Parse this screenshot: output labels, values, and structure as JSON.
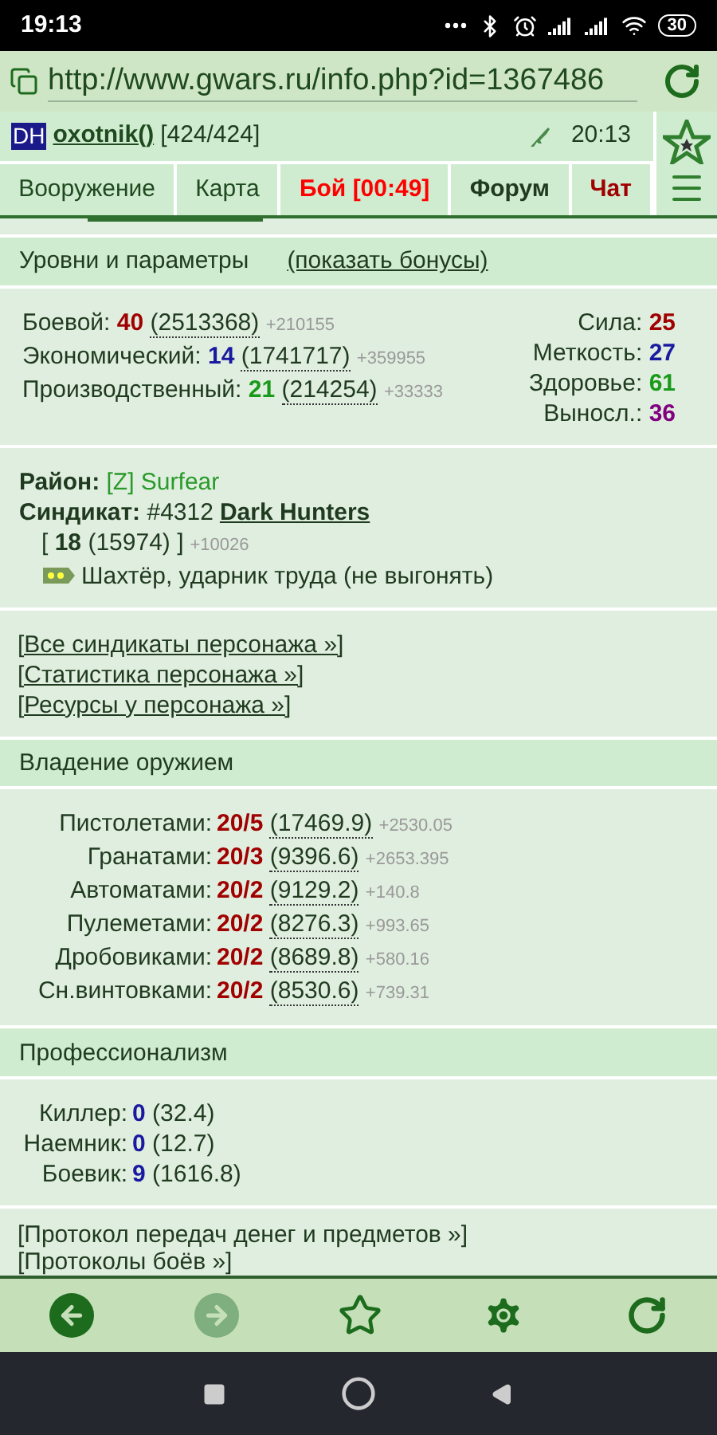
{
  "status_bar": {
    "time": "19:13",
    "battery": "30"
  },
  "browser": {
    "url": "http://www.gwars.ru/info.php?id=1367486"
  },
  "header": {
    "clan_tag": "DH",
    "player": "oxotnik()",
    "hp": "[424/424]",
    "server_time": "20:13"
  },
  "tabs": [
    {
      "label": "Вооружение",
      "kind": "normal"
    },
    {
      "label": "Карта",
      "kind": "normal"
    },
    {
      "label": "Бой [00:49]",
      "kind": "alert"
    },
    {
      "label": "Форум",
      "kind": "bold"
    },
    {
      "label": "Чат",
      "kind": "warn"
    }
  ],
  "levels": {
    "title": "Уровни и параметры",
    "bonus_link": "(показать бонусы)",
    "rows": [
      {
        "label": "Боевой:",
        "value": "40",
        "exp": "(2513368)",
        "gain": "+210155",
        "color": "#a00000"
      },
      {
        "label": "Экономический:",
        "value": "14",
        "exp": "(1741717)",
        "gain": "+359955",
        "color": "#1a1aa0"
      },
      {
        "label": "Производственный:",
        "value": "21",
        "exp": "(214254)",
        "gain": "+33333",
        "color": "#1a9a1a"
      }
    ],
    "stats": [
      {
        "label": "Сила:",
        "value": "25",
        "color": "#a00000"
      },
      {
        "label": "Меткость:",
        "value": "27",
        "color": "#1a1aa0"
      },
      {
        "label": "Здоровье:",
        "value": "61",
        "color": "#1a9a1a"
      },
      {
        "label": "Выносл.:",
        "value": "36",
        "color": "#800080"
      }
    ]
  },
  "district": {
    "label": "Район:",
    "value": "[Z] Surfear"
  },
  "syndicate": {
    "label": "Синдикат:",
    "number": "#4312",
    "name": "Dark Hunters",
    "level": "[ **18** (15974) ]",
    "gain": "+10026",
    "rank": "Шахтёр, ударник труда (не выгонять)"
  },
  "links": [
    "[Все синдикаты персонажа »]",
    "[Статистика персонажа »]",
    "[Ресурсы у персонажа »]"
  ],
  "weapons": {
    "title": "Владение оружием",
    "rows": [
      {
        "label": "Пистолетами:",
        "value": "20/5",
        "exp": "(17469.9)",
        "gain": "+2530.05"
      },
      {
        "label": "Гранатами:",
        "value": "20/3",
        "exp": "(9396.6)",
        "gain": "+2653.395"
      },
      {
        "label": "Автоматами:",
        "value": "20/2",
        "exp": "(9129.2)",
        "gain": "+140.8"
      },
      {
        "label": "Пулеметами:",
        "value": "20/2",
        "exp": "(8276.3)",
        "gain": "+993.65"
      },
      {
        "label": "Дробовиками:",
        "value": "20/2",
        "exp": "(8689.8)",
        "gain": "+580.16"
      },
      {
        "label": "Сн.винтовками:",
        "value": "20/2",
        "exp": "(8530.6)",
        "gain": "+739.31"
      }
    ]
  },
  "professionalism": {
    "title": "Профессионализм",
    "rows": [
      {
        "label": "Киллер:",
        "value": "0",
        "exp": "(32.4)"
      },
      {
        "label": "Наемник:",
        "value": "0",
        "exp": "(12.7)"
      },
      {
        "label": "Боевик:",
        "value": "9",
        "exp": "(1616.8)"
      }
    ]
  },
  "bottom_links": [
    "[Протокол передач денег и предметов »]",
    "[Протоколы боёв »]"
  ],
  "toolbar": [
    {
      "kind": "back",
      "disabled": false
    },
    {
      "kind": "forward",
      "disabled": true
    },
    {
      "kind": "star",
      "disabled": false
    },
    {
      "kind": "settings",
      "disabled": false
    },
    {
      "kind": "reload",
      "disabled": false
    }
  ]
}
